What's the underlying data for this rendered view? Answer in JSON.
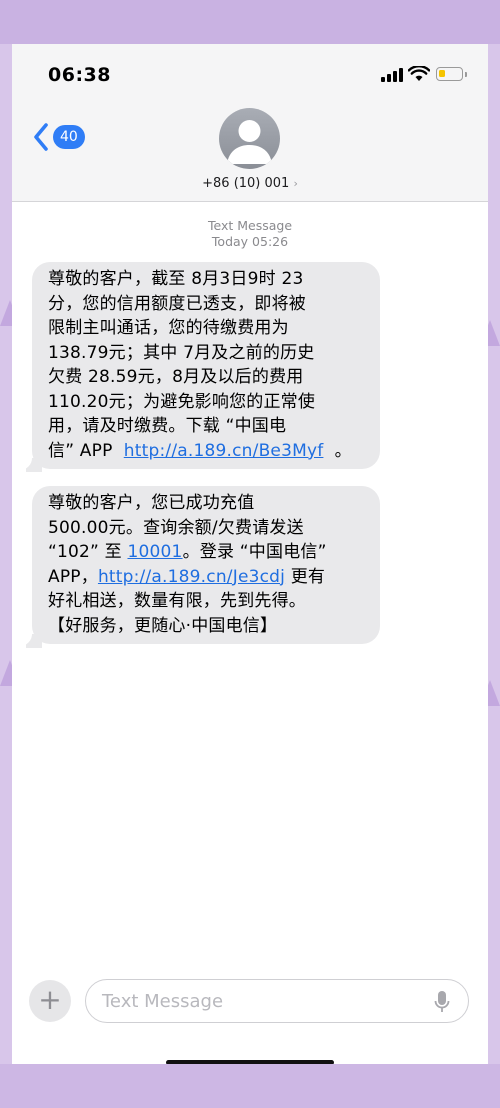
{
  "status_bar": {
    "time": "06:38"
  },
  "header": {
    "back_count": "40",
    "contact": "+86 (10) 001",
    "contact_chevron": "›"
  },
  "thread": {
    "service": "Text Message",
    "time": "Today 05:26"
  },
  "messages": [
    {
      "lines": [
        "尊敬的客户，截至 8月3日9时 23",
        "分，您的信用额度已透支，即将被",
        "限制主叫通话，您的待缴费用为",
        "138.79元；其中 7月及之前的历史",
        "欠费 28.59元，8月及以后的费用",
        "110.20元；为避免影响您的正常使",
        "用，请及时缴费。下载 “中国电"
      ],
      "last_prefix": "信” APP  ",
      "link": "http://a.189.cn/Be3Myf",
      "last_suffix": "  。"
    },
    {
      "line1": "尊敬的客户，您已成功充值",
      "line2": "500.00元。查询余额/欠费请发送",
      "line3_prefix": "“102” 至 ",
      "line3_link": "10001",
      "line3_suffix": "。登录 “中国电信”",
      "line4_prefix": "APP，",
      "line4_link": "http://a.189.cn/Je3cdj",
      "line4_suffix": " 更有",
      "line5": "好礼相送，数量有限，先到先得。",
      "line6": "【好服务，更随心·中国电信】"
    }
  ],
  "composer": {
    "plus": "+",
    "placeholder": "Text Message"
  },
  "icons": {
    "back": "chevron-left-icon",
    "avatar": "person-icon",
    "signal": "cellular-signal-icon",
    "wifi": "wifi-icon",
    "battery": "battery-icon",
    "mic": "microphone-icon"
  },
  "colors": {
    "accent": "#2f7df6",
    "link": "#1f6ee0",
    "bubble": "#e9e9eb",
    "battery": "#f5c400",
    "background": "#d8c6ea"
  }
}
